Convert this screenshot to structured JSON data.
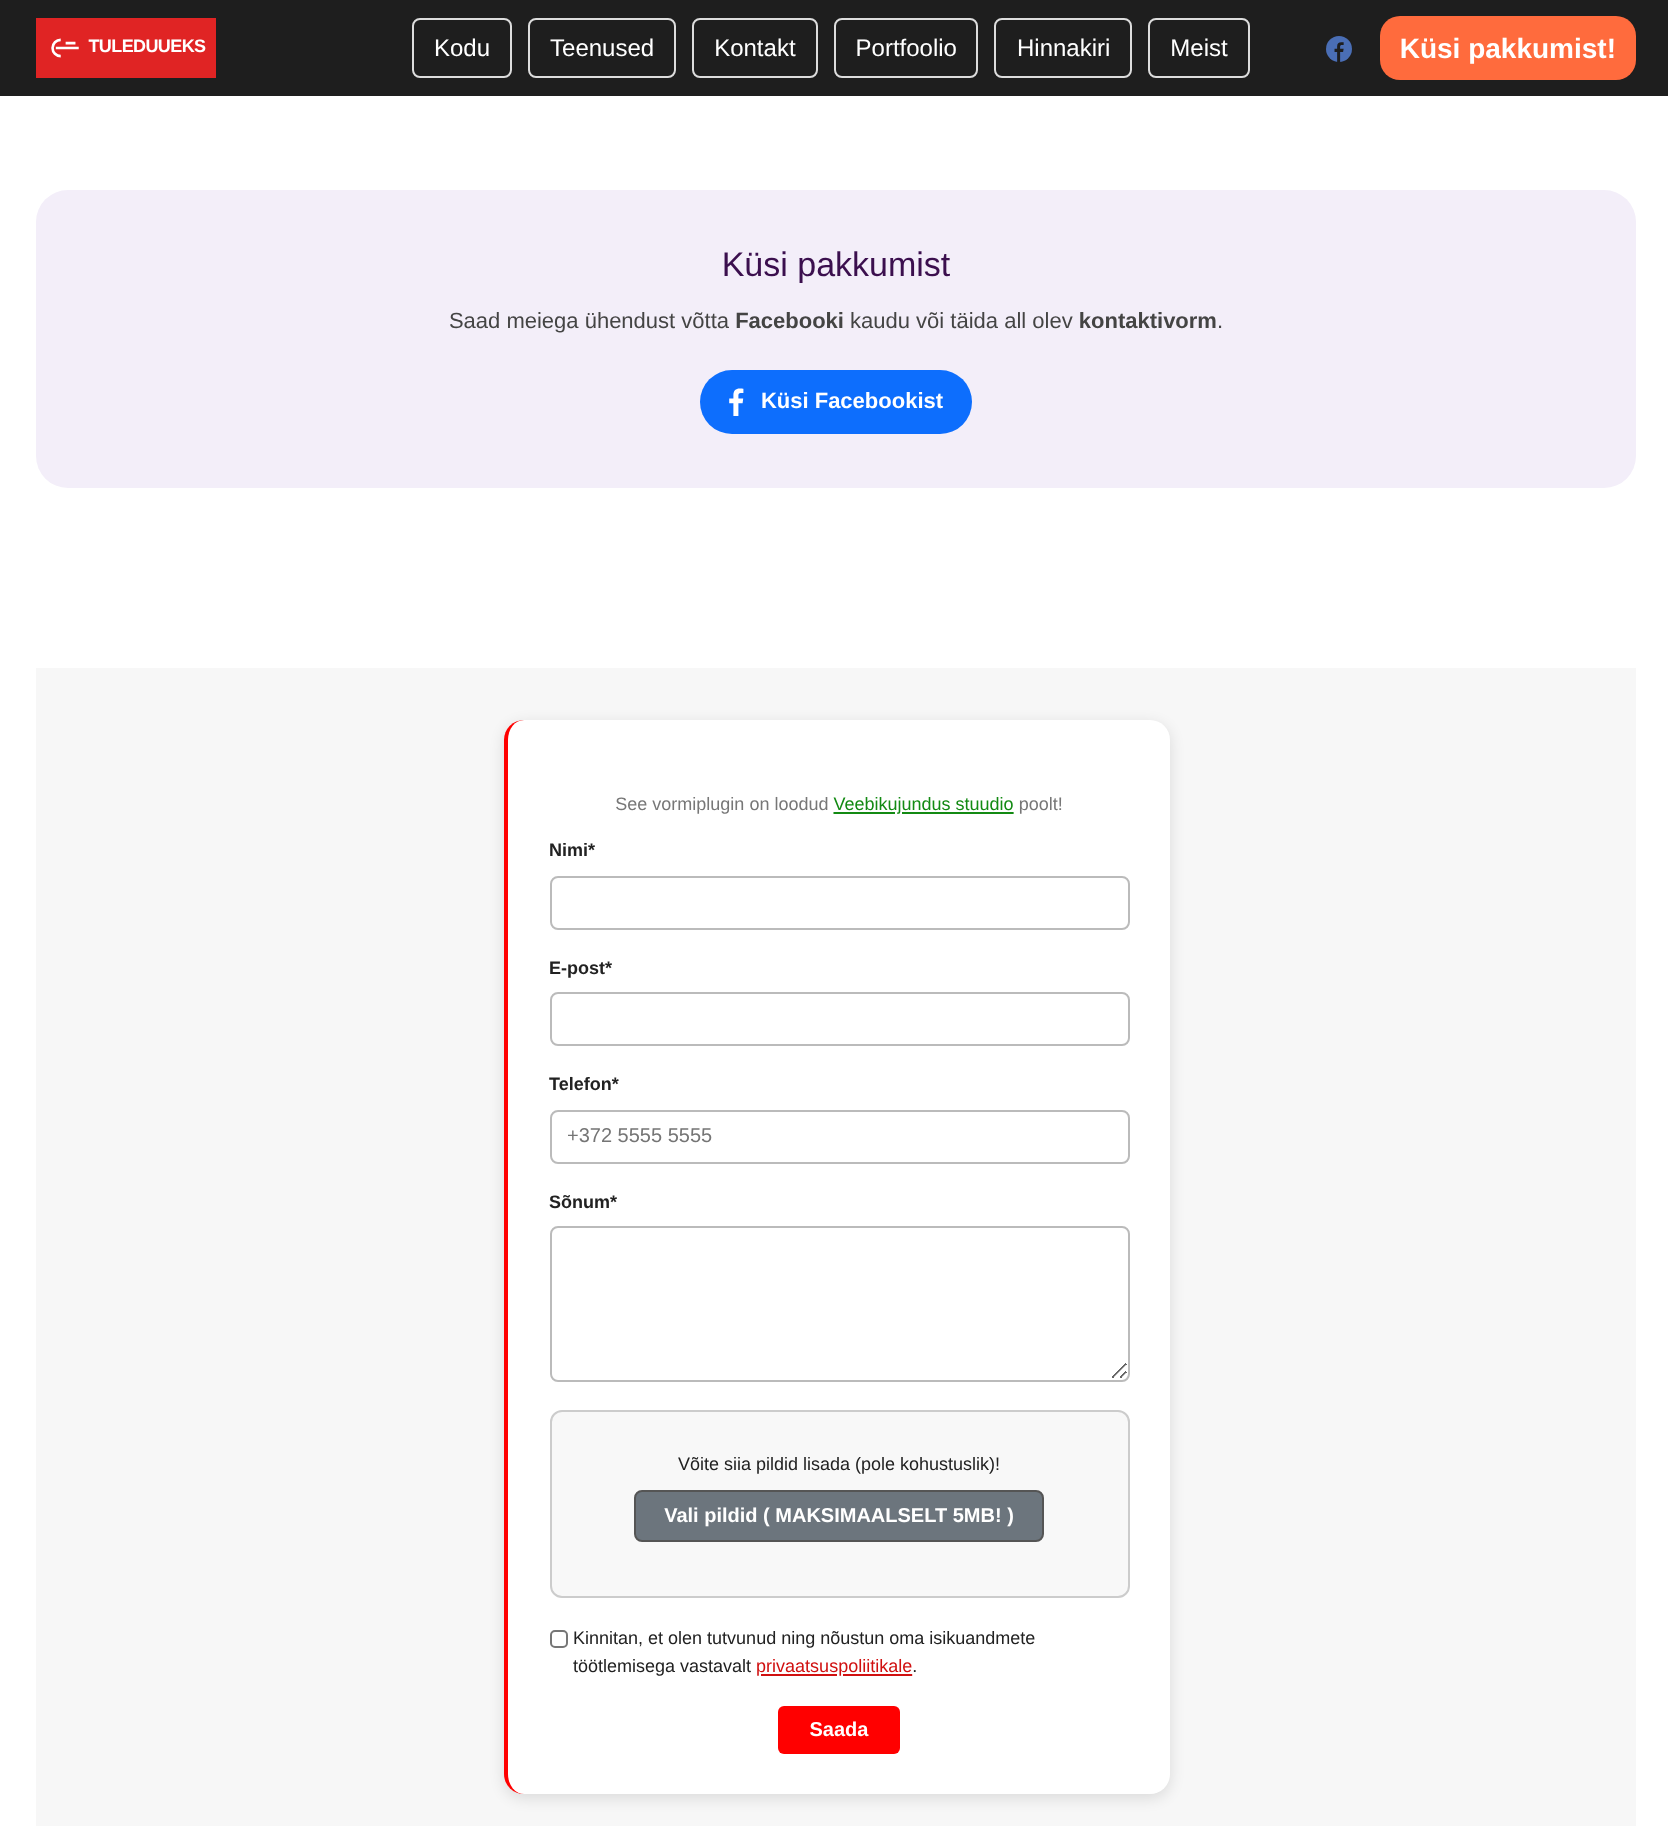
{
  "navbar": {
    "logo_text": "TULEDUUEKS",
    "links": [
      {
        "label": "Kodu"
      },
      {
        "label": "Teenused"
      },
      {
        "label": "Kontakt"
      },
      {
        "label": "Portfoolio"
      },
      {
        "label": "Hinnakiri"
      },
      {
        "label": "Meist"
      }
    ],
    "cta": "Küsi pakkumist!"
  },
  "hero": {
    "title": "Küsi pakkumist",
    "text": "Saad meiega ühendust võtta **Facebooki** kaudu või täida all olev **kontaktivorm**.",
    "button": "Küsi Facebookist"
  },
  "form": {
    "credit_before": "See vormiplugin on loodud",
    "credit_link": "Veebikujundus stuudio",
    "credit_after": "poolt!",
    "fields": [
      {
        "label": "Nimi*",
        "kind": "input"
      },
      {
        "label": "E-post*",
        "kind": "input"
      },
      {
        "label": "Telefon*",
        "kind": "input",
        "placeholder": "+372 5555 5555"
      },
      {
        "label": "Sõnum*",
        "kind": "textarea"
      }
    ],
    "upload": {
      "text": "Võite siia pildid lisada (pole kohustuslik)!",
      "button": "Vali pildid ( MAKSIMAALSELT 5MB! )"
    },
    "consent": {
      "checked": false,
      "text_before": "Kinnitan, et olen tutvunud ning nõustun oma isikuandmete töötlemisega vastavalt",
      "link": "privaatsuspoliitikale",
      "text_after": "."
    },
    "submit": "Saada"
  }
}
